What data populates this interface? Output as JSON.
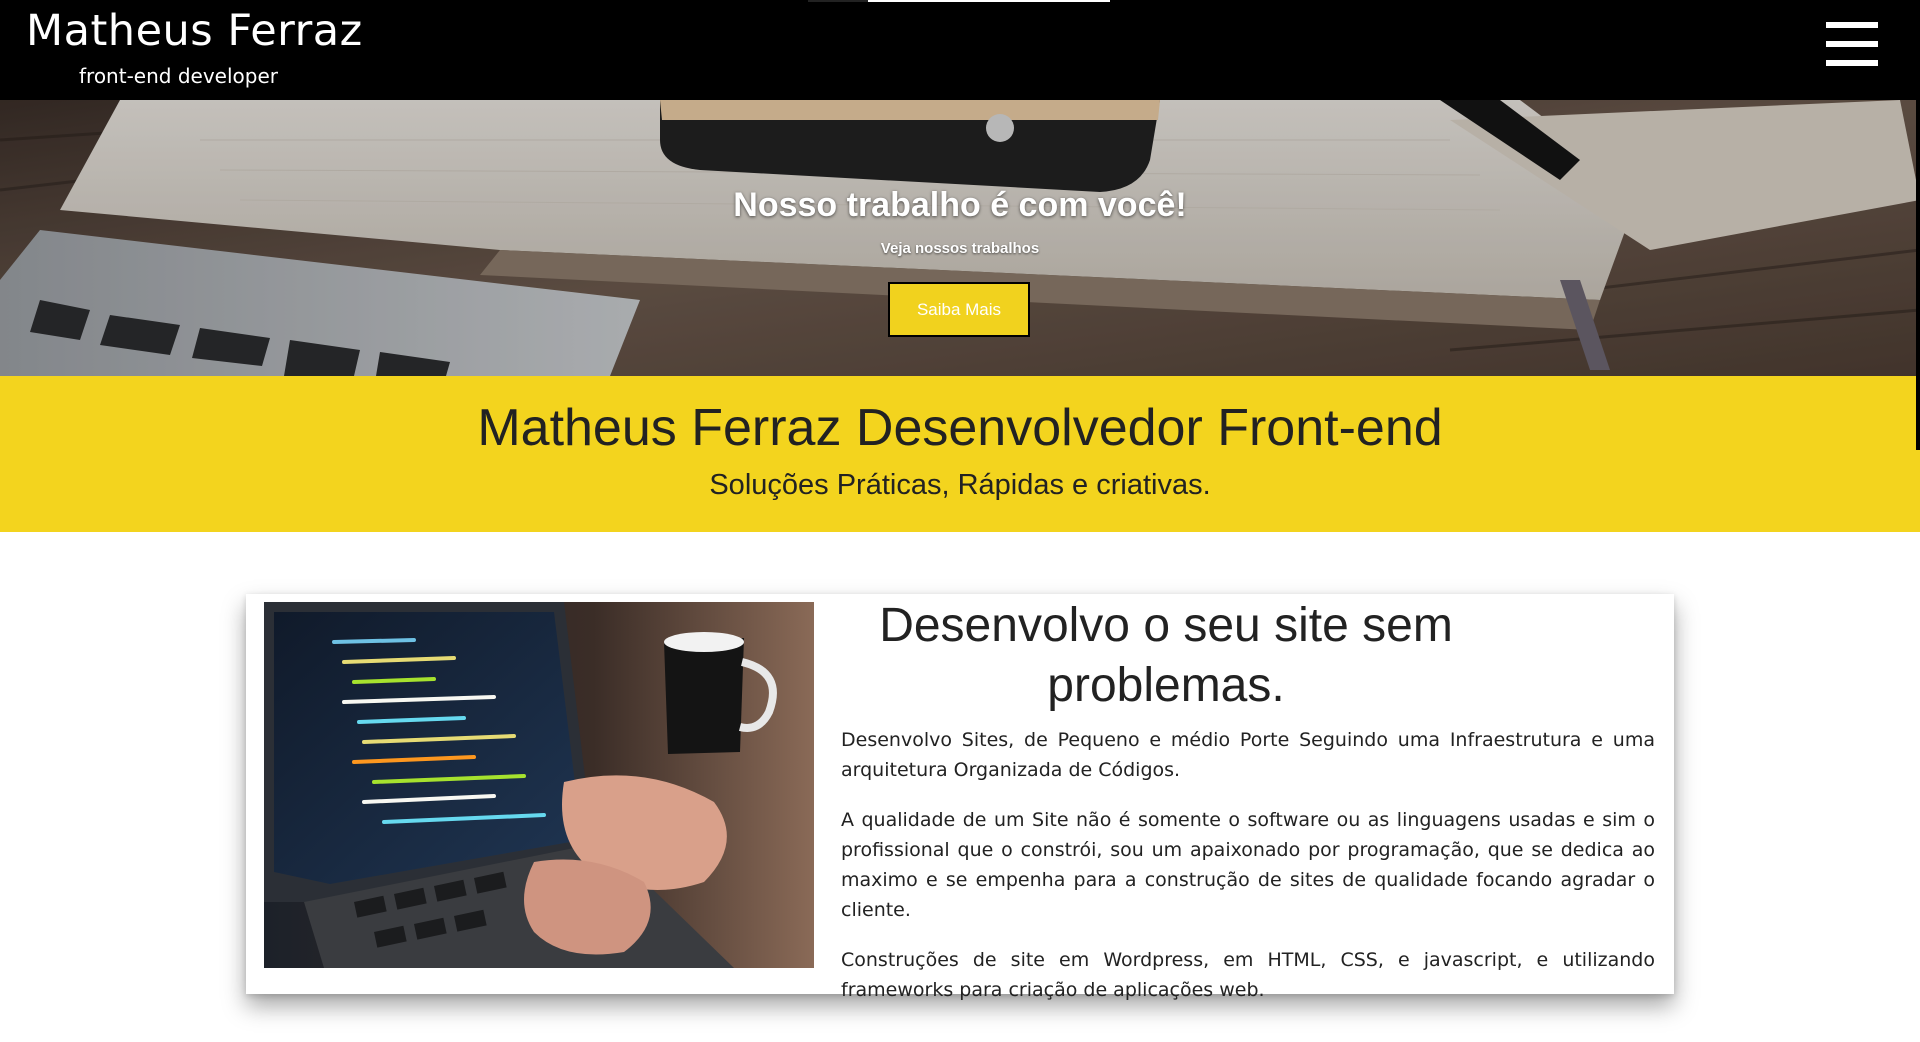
{
  "header": {
    "title": "Matheus Ferraz",
    "subtitle": "front-end developer",
    "menu_icon": "hamburger-menu-icon"
  },
  "hero": {
    "title": "Nosso trabalho é com você!",
    "subtitle": "Veja nossos trabalhos",
    "button_label": "Saiba Mais"
  },
  "band": {
    "title": "Matheus Ferraz Desenvolvedor Front-end",
    "subtitle": "Soluções Práticas, Rápidas e criativas."
  },
  "card": {
    "title": "Desenvolvo o seu site sem problemas.",
    "paragraphs": [
      "Desenvolvo Sites, de Pequeno e médio Porte Seguindo uma Infraestrutura e uma arquitetura Organizada de Códigos.",
      "A qualidade de um Site não é somente o software ou as linguagens usadas e sim o profissional que o constrói, sou um apaixonado por programação, que se dedica ao maximo e se empenha para a construção de sites de qualidade focando agradar o cliente.",
      "Construções de site em Wordpress, em HTML, CSS, e javascript, e utilizando frameworks para criação de aplicações web."
    ]
  },
  "colors": {
    "header_bg": "#000000",
    "accent_yellow": "#f3d41e",
    "text_dark": "#222222",
    "white": "#ffffff"
  }
}
